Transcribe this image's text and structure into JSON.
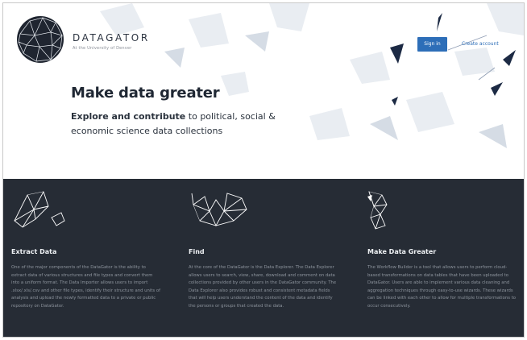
{
  "brand": {
    "name": "DATAGATOR",
    "subtitle": "At the University of Denver"
  },
  "nav": {
    "signin": "Sign in",
    "create": "Create account"
  },
  "hero": {
    "headline": "Make data greater",
    "tagline_bold": "Explore and contribute",
    "tagline_rest": " to political, social & economic science data collections"
  },
  "features": [
    {
      "title": "Extract Data",
      "text": "One of the major components of the DataGator is the ability to extract data of various structures and file types and convert them into a uniform format. The Data Importer allows users to import .xlsx/.xls/.csv and other file types, identify their structure and units of analysis and upload the newly formatted data to a private or public repository on DataGator."
    },
    {
      "title": "Find",
      "text": "At the core of the DataGator is the Data Explorer. The Data Explorer allows users to search, view, share, download and comment on data collections provided by other users in the DataGator community. The Data Explorer also provides robust and consistent metadata fields that will help users understand the content of the data and identify the persons or groups that created the data."
    },
    {
      "title": "Make Data Greater",
      "text": "The Workflow Builder is a tool that allows users to perform cloud-based transformations on data tables that have been uploaded to DataGator. Users are able to implement various data cleaning and aggregation techniques through easy-to-use wizards. These wizards can be linked with each other to allow for multiple transformations to occur consecutively."
    }
  ],
  "colors": {
    "accent": "#2d6eb8",
    "dark": "#262c35"
  }
}
